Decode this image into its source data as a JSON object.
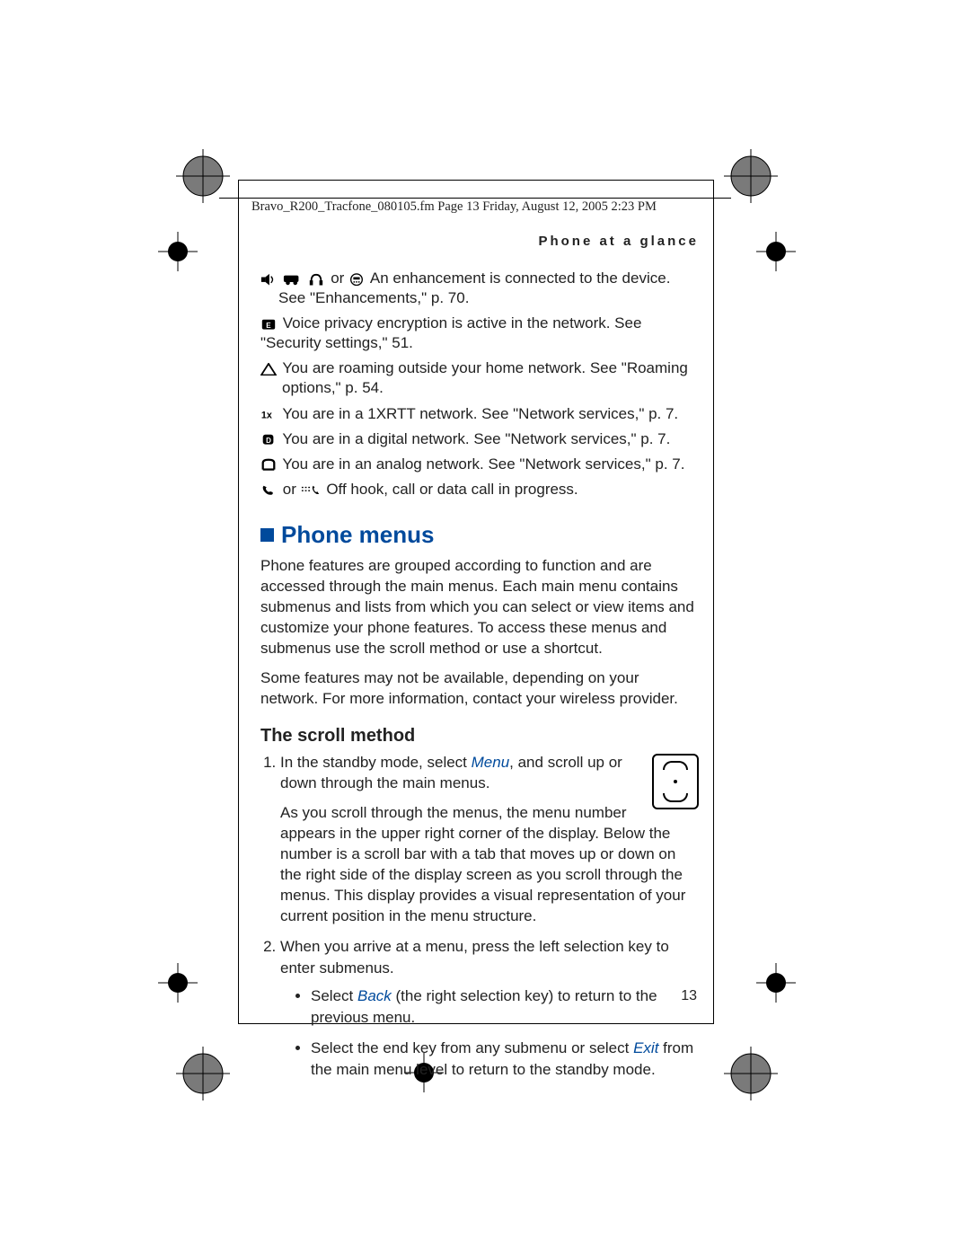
{
  "header": "Bravo_R200_Tracfone_080105.fm  Page 13  Friday, August 12, 2005  2:23 PM",
  "running_head": "Phone at a glance",
  "icons": {
    "line1_or": "or",
    "line1_text": "An enhancement is connected to the device.",
    "line1_sub": "See \"Enhancements,\" p. 70.",
    "line2": "Voice privacy encryption is active in the network. See \"Security settings,\" 51.",
    "line3a": "You are roaming outside your home network. See \"Roaming",
    "line3b": "options,\" p. 54.",
    "line4": "You are in a 1XRTT network. See \"Network services,\" p. 7.",
    "line5": "You are in a digital network. See \"Network services,\" p. 7.",
    "line6": "You are in an analog network. See \"Network services,\" p. 7.",
    "line7_or": "or",
    "line7": "Off hook, call or data call in progress."
  },
  "section_title": "Phone menus",
  "para1": "Phone features are grouped according to function and are accessed through the main menus. Each main menu contains submenus and lists from which you can select or view items and customize your phone features. To access these menus and submenus use the scroll method or use a shortcut.",
  "para2": "Some features may not be available, depending on your network. For more information, contact your wireless provider.",
  "subhead": "The scroll method",
  "step1_a": "In the standby mode, select ",
  "step1_menu": "Menu",
  "step1_b": ", and scroll up or down through the main menus.",
  "step1_p2": "As you scroll through the menus, the menu number appears in the upper right corner of the display. Below the number is a scroll bar with a tab that moves up or down on the right side of the display screen as you scroll through the menus. This display provides a visual representation of your current position in the menu structure.",
  "step2": "When you arrive at a menu, press the left selection key to enter submenus.",
  "bullet1_a": "Select ",
  "bullet1_back": "Back",
  "bullet1_b": " (the right selection key) to return to the previous menu.",
  "bullet2_a": "Select the end key from any submenu or select ",
  "bullet2_exit": "Exit",
  "bullet2_b": " from the main menu level to return to the standby mode.",
  "page_number": "13"
}
